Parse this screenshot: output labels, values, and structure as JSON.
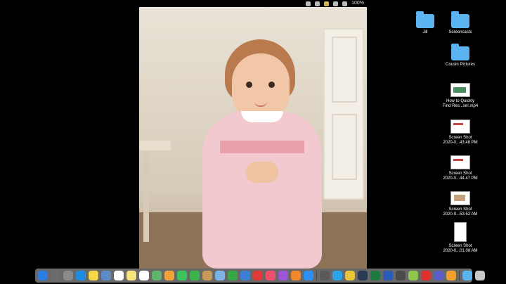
{
  "menubar": {
    "battery": "100%"
  },
  "desktop_items": [
    {
      "label": "Jill",
      "kind": "folder"
    },
    {
      "label": "Screencasts",
      "kind": "folder"
    },
    {
      "label": "Cousin Pictures",
      "kind": "folder"
    },
    {
      "label": "How to Quickly\nFind Res...se!.mp4",
      "kind": "video"
    },
    {
      "label": "Screen Shot\n2020-0...43.48 PM",
      "kind": "screenshot"
    },
    {
      "label": "Screen Shot\n2020-0...44.47 PM",
      "kind": "screenshot"
    },
    {
      "label": "Screen Shot\n2020-0...53.52 AM",
      "kind": "screenshot"
    },
    {
      "label": "Screen Shot\n2020-0...01.08 AM",
      "kind": "screenshot"
    }
  ],
  "dock_icons": [
    {
      "name": "finder-icon",
      "color": "#2b7de0"
    },
    {
      "name": "launchpad-icon",
      "color": "#6b6b6b"
    },
    {
      "name": "system-preferences-icon",
      "color": "#8a8a8a"
    },
    {
      "name": "safari-icon",
      "color": "#1f8be0"
    },
    {
      "name": "notes-icon",
      "color": "#f7d64a"
    },
    {
      "name": "image-capture-icon",
      "color": "#5b8cc5"
    },
    {
      "name": "calendar-icon",
      "color": "#ffffff"
    },
    {
      "name": "stickies-icon",
      "color": "#f8e27a"
    },
    {
      "name": "reminders-icon",
      "color": "#ffffff"
    },
    {
      "name": "maps-icon",
      "color": "#5fb36a"
    },
    {
      "name": "photos-icon",
      "color": "#f0a33b"
    },
    {
      "name": "messages-icon",
      "color": "#39c55a"
    },
    {
      "name": "facetime-icon",
      "color": "#3ab54a"
    },
    {
      "name": "contacts-icon",
      "color": "#c89a5a"
    },
    {
      "name": "finder-window-icon",
      "color": "#7ab4e8"
    },
    {
      "name": "numbers-icon",
      "color": "#3aa64a"
    },
    {
      "name": "keynote-icon",
      "color": "#3b7fd6"
    },
    {
      "name": "no-entry-icon",
      "color": "#e03a3a"
    },
    {
      "name": "music-icon",
      "color": "#ef4f6a"
    },
    {
      "name": "podcasts-icon",
      "color": "#9b55d6"
    },
    {
      "name": "books-icon",
      "color": "#f0882e"
    },
    {
      "name": "app-store-icon",
      "color": "#2f8ff0"
    },
    {
      "name": "screenflow-icon",
      "color": "#5a5a5a"
    },
    {
      "name": "skype-icon",
      "color": "#2ea3e8"
    },
    {
      "name": "chrome-icon",
      "color": "#e8c43a"
    },
    {
      "name": "steam-icon",
      "color": "#2a3a55"
    },
    {
      "name": "excel-icon",
      "color": "#1e7a43"
    },
    {
      "name": "word-icon",
      "color": "#2b5cb8"
    },
    {
      "name": "quicktime-icon",
      "color": "#4a4a4a"
    },
    {
      "name": "android-file-transfer-icon",
      "color": "#8fc54a"
    },
    {
      "name": "task-icon",
      "color": "#e0312e"
    },
    {
      "name": "teams-icon",
      "color": "#5b5fc7"
    },
    {
      "name": "settings-icon",
      "color": "#f0a030"
    },
    {
      "name": "downloads-folder-icon",
      "color": "#5bb3ef"
    },
    {
      "name": "trash-icon",
      "color": "#c8c8c8"
    }
  ]
}
